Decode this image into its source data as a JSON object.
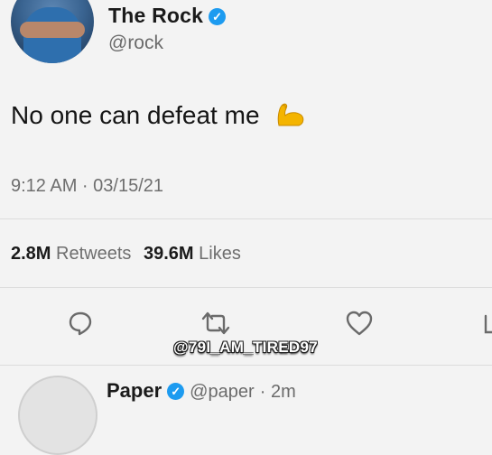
{
  "tweet": {
    "author_name": "The Rock",
    "author_handle": "@rock",
    "text": "No one can defeat me",
    "emoji": "flexed-biceps",
    "timestamp": "9:12 AM · 03/15/21",
    "retweets_count": "2.8M",
    "retweets_label": "Retweets",
    "likes_count": "39.6M",
    "likes_label": "Likes"
  },
  "watermark": "@79I_AM_TIRED97",
  "reply": {
    "author_name": "Paper",
    "author_handle": "@paper",
    "time": "· 2m"
  },
  "colors": {
    "verified": "#1d9bf0",
    "emoji": "#f4b400"
  }
}
